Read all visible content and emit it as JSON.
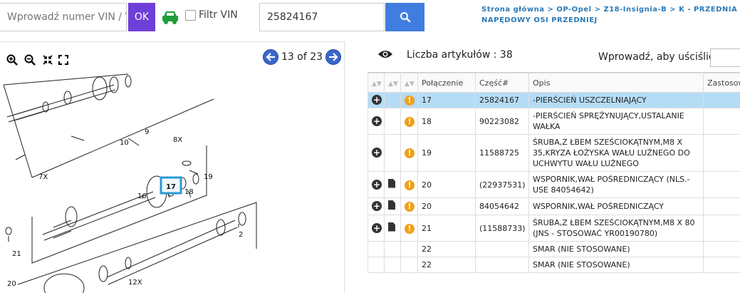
{
  "topbar": {
    "vin_placeholder": "Wprowadź numer VIN / V",
    "ok_label": "OK",
    "vin_filter_label": "Filtr VIN",
    "search_value": "25824167",
    "colors": {
      "ok": "#6f3fd9",
      "search": "#3f7de0",
      "car": "#1e9e3a"
    }
  },
  "breadcrumb": {
    "items": [
      "Strona główna",
      "OP-Opel",
      "Z18-Insignia-B",
      "K - PRZEDNIA OŚ I Z"
    ],
    "line2": "NAPĘDOWY OSI PRZEDNIEJ"
  },
  "diagram": {
    "page_label": "13 of 23",
    "tools": [
      "zoom-in-icon",
      "zoom-out-icon",
      "shrink-icon",
      "fullscreen-icon"
    ],
    "callouts": [
      "9",
      "8X",
      "10",
      "7X",
      "19",
      "16",
      "17",
      "18",
      "2",
      "21",
      "20",
      "12X"
    ],
    "highlighted_callout": "17"
  },
  "panel": {
    "count_label": "Liczba artykułów : 38",
    "filter_label": "Wprowadź, aby uściślić :"
  },
  "table": {
    "headers": [
      "",
      "",
      "",
      "Połączenie",
      "Część#",
      "Opis",
      "Zastosowanie"
    ],
    "rows": [
      {
        "plus": true,
        "doc": false,
        "warn": true,
        "conn": "17",
        "part": "25824167",
        "desc": "-PIERŚCIEŃ USZCZELNIAJĄCY",
        "selected": true
      },
      {
        "plus": true,
        "doc": false,
        "warn": true,
        "conn": "18",
        "part": "90223082",
        "desc": "-PIERŚCIEŃ SPRĘŻYNUJĄCY,USTALANIE WAŁKA",
        "selected": false
      },
      {
        "plus": true,
        "doc": false,
        "warn": true,
        "conn": "19",
        "part": "11588725",
        "desc": "ŚRUBA,Z ŁBEM SZEŚCIOKĄTNYM,M8 X 35,KRYZA ŁOŻYSKA WAŁU LUŹNEGO DO UCHWYTU WAŁU LUŹNEGO",
        "selected": false
      },
      {
        "plus": true,
        "doc": true,
        "warn": true,
        "conn": "20",
        "part": "(22937531)",
        "desc": "WSPORNIK,WAŁ POŚREDNICZĄCY (NLS.- USE 84054642)",
        "selected": false
      },
      {
        "plus": true,
        "doc": true,
        "warn": true,
        "conn": "20",
        "part": "84054642",
        "desc": "WSPORNIK,WAŁ POŚREDNICZĄCY",
        "selected": false
      },
      {
        "plus": true,
        "doc": true,
        "warn": true,
        "conn": "21",
        "part": "(11588733)",
        "desc": "ŚRUBA,Z ŁBEM SZEŚCIOKĄTNYM,M8 X 80 (JNS - STOSOWAĆ YR00190780)",
        "selected": false
      },
      {
        "plus": false,
        "doc": false,
        "warn": false,
        "conn": "22",
        "part": "",
        "desc": "SMAR (NIE STOSOWANE)",
        "selected": false
      },
      {
        "plus": false,
        "doc": false,
        "warn": false,
        "conn": "22",
        "part": "",
        "desc": "SMAR (NIE STOSOWANE)",
        "selected": false
      }
    ]
  }
}
